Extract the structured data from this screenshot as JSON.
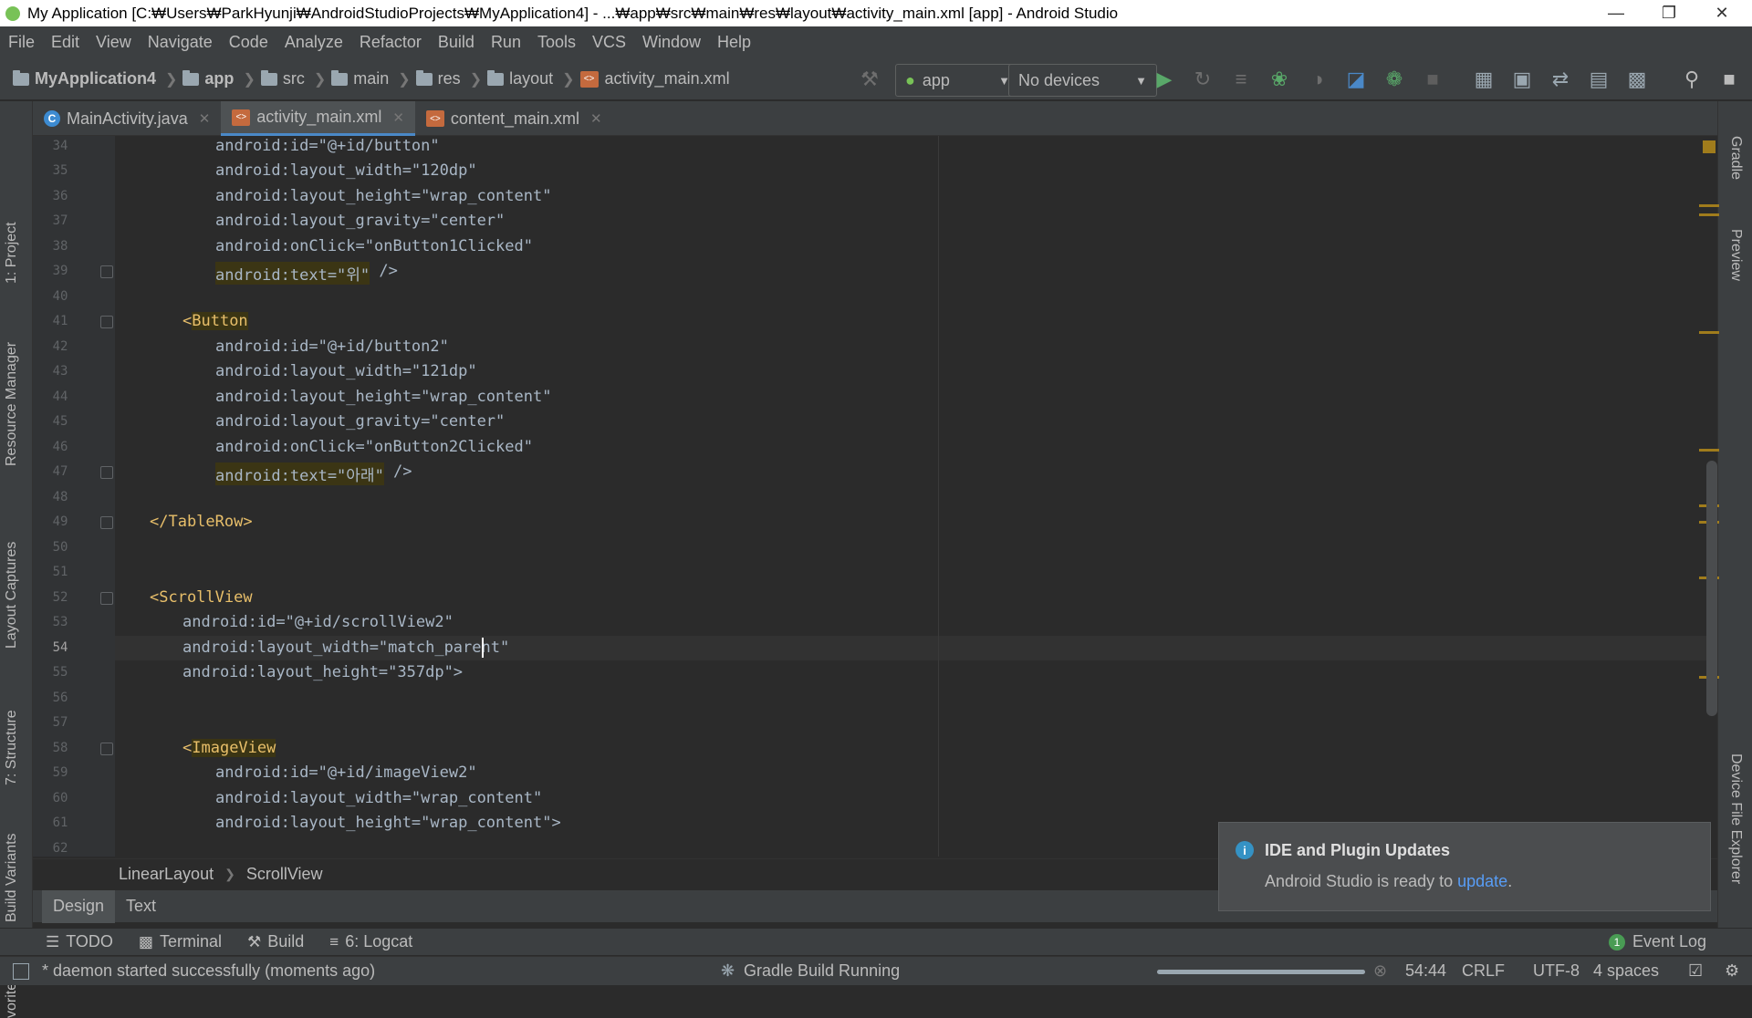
{
  "window": {
    "title": "My Application [C:₩Users₩ParkHyunji₩AndroidStudioProjects₩MyApplication4] - ...₩app₩src₩main₩res₩layout₩activity_main.xml [app] - Android Studio"
  },
  "menu": [
    "File",
    "Edit",
    "View",
    "Navigate",
    "Code",
    "Analyze",
    "Refactor",
    "Build",
    "Run",
    "Tools",
    "VCS",
    "Window",
    "Help"
  ],
  "breadcrumbs": [
    "MyApplication4",
    "app",
    "src",
    "main",
    "res",
    "layout",
    "activity_main.xml"
  ],
  "toolbar": {
    "run_config": "app",
    "device": "No devices"
  },
  "tabs": [
    {
      "label": "MainActivity.java",
      "active": false
    },
    {
      "label": "activity_main.xml",
      "active": true
    },
    {
      "label": "content_main.xml",
      "active": false
    }
  ],
  "left_tools": [
    "1: Project",
    "Resource Manager",
    "Layout Captures",
    "7: Structure",
    "Build Variants",
    "vorites"
  ],
  "right_tools": [
    "Gradle",
    "Preview",
    "Device File Explorer"
  ],
  "editor": {
    "line_numbers": [
      "34",
      "35",
      "36",
      "37",
      "38",
      "39",
      "40",
      "41",
      "42",
      "43",
      "44",
      "45",
      "46",
      "47",
      "48",
      "49",
      "50",
      "51",
      "52",
      "53",
      "54",
      "55",
      "56",
      "57",
      "58",
      "59",
      "60",
      "61",
      "62"
    ],
    "current_line": "54"
  },
  "code_lines": {
    "l34": "android:id=\"@+id/button\"",
    "l35": "android:layout_width=\"120dp\"",
    "l36": "android:layout_height=\"wrap_content\"",
    "l37": "android:layout_gravity=\"center\"",
    "l38": "android:onClick=\"onButton1Clicked\"",
    "l39a": "android:text=\"위\"",
    "l39b": " />",
    "l41": "Button",
    "l42": "android:id=\"@+id/button2\"",
    "l43": "android:layout_width=\"121dp\"",
    "l44": "android:layout_height=\"wrap_content\"",
    "l45": "android:layout_gravity=\"center\"",
    "l46": "android:onClick=\"onButton2Clicked\"",
    "l47a": "android:text=\"아래\"",
    "l47b": " />",
    "l49": "</TableRow>",
    "l52": "<ScrollView",
    "l53": "android:id=\"@+id/scrollView2\"",
    "l54": "android:layout_width=\"match_parent\"",
    "l55": "android:layout_height=\"357dp\">",
    "l58": "ImageView",
    "l59": "android:id=\"@+id/imageView2\"",
    "l60": "android:layout_width=\"wrap_content\"",
    "l61": "android:layout_height=\"wrap_content\">"
  },
  "path_breadcrumb": [
    "LinearLayout",
    "ScrollView"
  ],
  "view_tabs": [
    "Design",
    "Text"
  ],
  "tool_windows": [
    "TODO",
    "Terminal",
    "Build",
    "6: Logcat"
  ],
  "event_log": {
    "count": "1",
    "label": "Event Log"
  },
  "notification": {
    "title": "IDE and Plugin Updates",
    "body": "Android Studio is ready to ",
    "link": "update",
    "after": "."
  },
  "status": {
    "message": "* daemon started successfully (moments ago)",
    "task": "Gradle Build Running",
    "position": "54:44",
    "line_sep": "CRLF",
    "encoding": "UTF-8",
    "indent": "4 spaces"
  }
}
